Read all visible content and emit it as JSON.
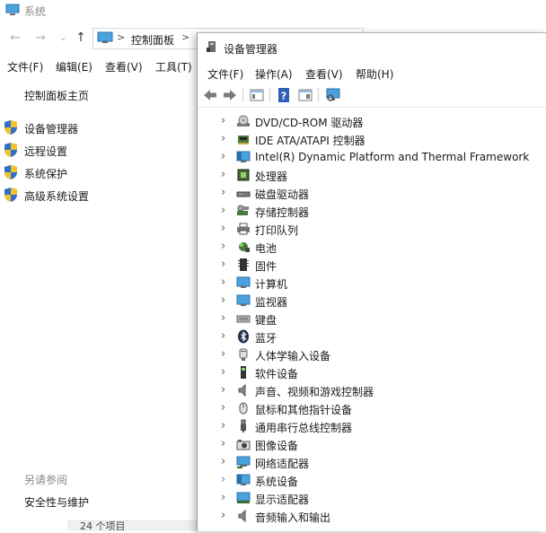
{
  "system_window": {
    "title": "系统",
    "address": {
      "crumb": "控制面板",
      "sep": ">"
    },
    "nav": {
      "back": "←",
      "forward": "→",
      "recent": "⌄",
      "up": "↑"
    },
    "menu": [
      "文件(F)",
      "编辑(E)",
      "查看(V)",
      "工具(T)"
    ],
    "sidebar": {
      "home": "控制面板主页",
      "links": [
        "设备管理器",
        "远程设置",
        "系统保护",
        "高级系统设置"
      ],
      "see_also_title": "另请参阅",
      "see_also_link": "安全性与维护"
    },
    "bottom_strip_text": "24 个项目"
  },
  "device_manager": {
    "title": "设备管理器",
    "menu": [
      "文件(F)",
      "操作(A)",
      "查看(V)",
      "帮助(H)"
    ],
    "tree_items": [
      {
        "label": "DVD/CD-ROM 驱动器",
        "icon": "disc-drive-icon"
      },
      {
        "label": "IDE ATA/ATAPI 控制器",
        "icon": "ide-controller-icon"
      },
      {
        "label": "Intel(R) Dynamic Platform and Thermal Framework",
        "icon": "thermal-framework-icon"
      },
      {
        "label": "处理器",
        "icon": "processor-icon"
      },
      {
        "label": "磁盘驱动器",
        "icon": "disk-drive-icon"
      },
      {
        "label": "存储控制器",
        "icon": "storage-controller-icon"
      },
      {
        "label": "打印队列",
        "icon": "printer-icon"
      },
      {
        "label": "电池",
        "icon": "battery-icon"
      },
      {
        "label": "固件",
        "icon": "firmware-icon"
      },
      {
        "label": "计算机",
        "icon": "computer-icon"
      },
      {
        "label": "监视器",
        "icon": "monitor-icon"
      },
      {
        "label": "键盘",
        "icon": "keyboard-icon"
      },
      {
        "label": "蓝牙",
        "icon": "bluetooth-icon"
      },
      {
        "label": "人体学输入设备",
        "icon": "hid-icon"
      },
      {
        "label": "软件设备",
        "icon": "software-device-icon"
      },
      {
        "label": "声音、视频和游戏控制器",
        "icon": "speaker-icon"
      },
      {
        "label": "鼠标和其他指针设备",
        "icon": "mouse-icon"
      },
      {
        "label": "通用串行总线控制器",
        "icon": "usb-icon"
      },
      {
        "label": "图像设备",
        "icon": "camera-icon"
      },
      {
        "label": "网络适配器",
        "icon": "network-adapter-icon"
      },
      {
        "label": "系统设备",
        "icon": "system-device-icon"
      },
      {
        "label": "显示适配器",
        "icon": "display-adapter-icon"
      },
      {
        "label": "音频输入和输出",
        "icon": "audio-io-icon"
      }
    ]
  },
  "colors": {
    "accent": "#3b8fd6",
    "monitor_blue": "#4aa3df",
    "shield_blue": "#2f6fc8",
    "shield_yellow": "#f2c12e"
  }
}
